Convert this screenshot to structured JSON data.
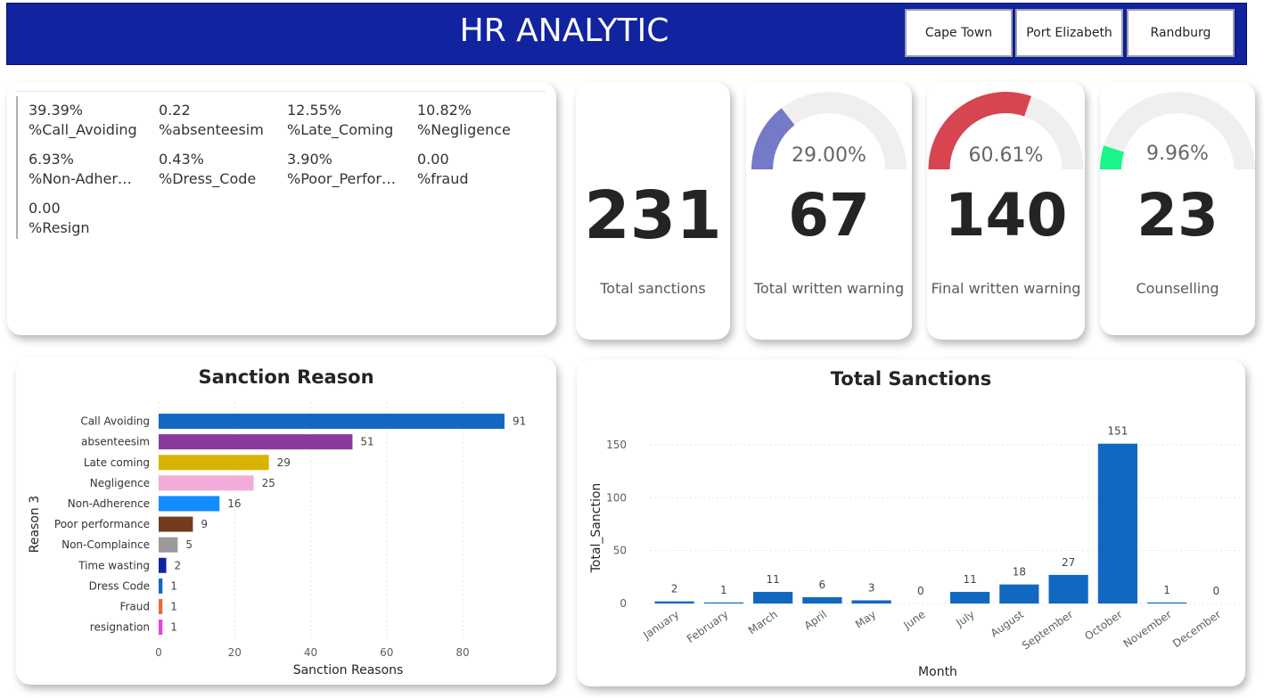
{
  "header": {
    "title": "HR ANALYTIC",
    "slicers": [
      "Cape Town",
      "Port Elizabeth",
      "Randburg"
    ]
  },
  "kpis": [
    {
      "value": "39.39%",
      "label": "%Call_Avoiding"
    },
    {
      "value": "0.22",
      "label": "%absenteesim"
    },
    {
      "value": "12.55%",
      "label": "%Late_Coming"
    },
    {
      "value": "10.82%",
      "label": "%Negligence"
    },
    {
      "value": "6.93%",
      "label": "%Non-Adher…"
    },
    {
      "value": "0.43%",
      "label": "%Dress_Code"
    },
    {
      "value": "3.90%",
      "label": "%Poor_Perfor…"
    },
    {
      "value": "0.00",
      "label": "%fraud"
    },
    {
      "value": "0.00",
      "label": "%Resign"
    }
  ],
  "cards": {
    "total_sanctions": {
      "value": "231",
      "label": "Total sanctions"
    },
    "written_warning": {
      "value": "67",
      "label": "Total written warning",
      "pct_text": "29.00%",
      "pct": 0.29,
      "color": "#7479C8"
    },
    "final_warning": {
      "value": "140",
      "label": "Final written warning",
      "pct_text": "60.61%",
      "pct": 0.6061,
      "color": "#D64550"
    },
    "counselling": {
      "value": "23",
      "label": "Counselling",
      "pct_text": "9.96%",
      "pct": 0.0996,
      "color": "#1AF58A"
    }
  },
  "gauge_track_color": "#F0EFEE",
  "chart_data": [
    {
      "type": "bar",
      "orientation": "horizontal",
      "title": "Sanction Reason",
      "xlabel": "Sanction Reasons",
      "ylabel": "Reason 3",
      "categories": [
        "Call Avoiding",
        "absenteesim",
        "Late coming",
        "Negligence",
        "Non-Adherence",
        "Poor performance",
        "Non-Complaince",
        "Time wasting",
        "Dress Code",
        "Fraud",
        "resignation"
      ],
      "values": [
        91,
        51,
        29,
        25,
        16,
        9,
        5,
        2,
        1,
        1,
        1
      ],
      "colors": [
        "#1068C1",
        "#8A3A9C",
        "#D9B300",
        "#F2ACD9",
        "#118DFF",
        "#743C1E",
        "#9A9A9A",
        "#12239E",
        "#1068C1",
        "#E66C37",
        "#E044D9"
      ],
      "xticks": [
        0,
        20,
        40,
        60,
        80
      ],
      "xlim": [
        0,
        95
      ],
      "grid": true
    },
    {
      "type": "bar",
      "title": "Total Sanctions",
      "xlabel": "Month",
      "ylabel": "Total_Sanction",
      "categories": [
        "January",
        "February",
        "March",
        "April",
        "May",
        "June",
        "July",
        "August",
        "September",
        "October",
        "November",
        "December"
      ],
      "values": [
        2,
        1,
        11,
        6,
        3,
        0,
        11,
        18,
        27,
        151,
        1,
        0
      ],
      "color": "#1068C1",
      "yticks": [
        0,
        50,
        100,
        150
      ],
      "ylim": [
        0,
        160
      ],
      "grid": true
    }
  ]
}
